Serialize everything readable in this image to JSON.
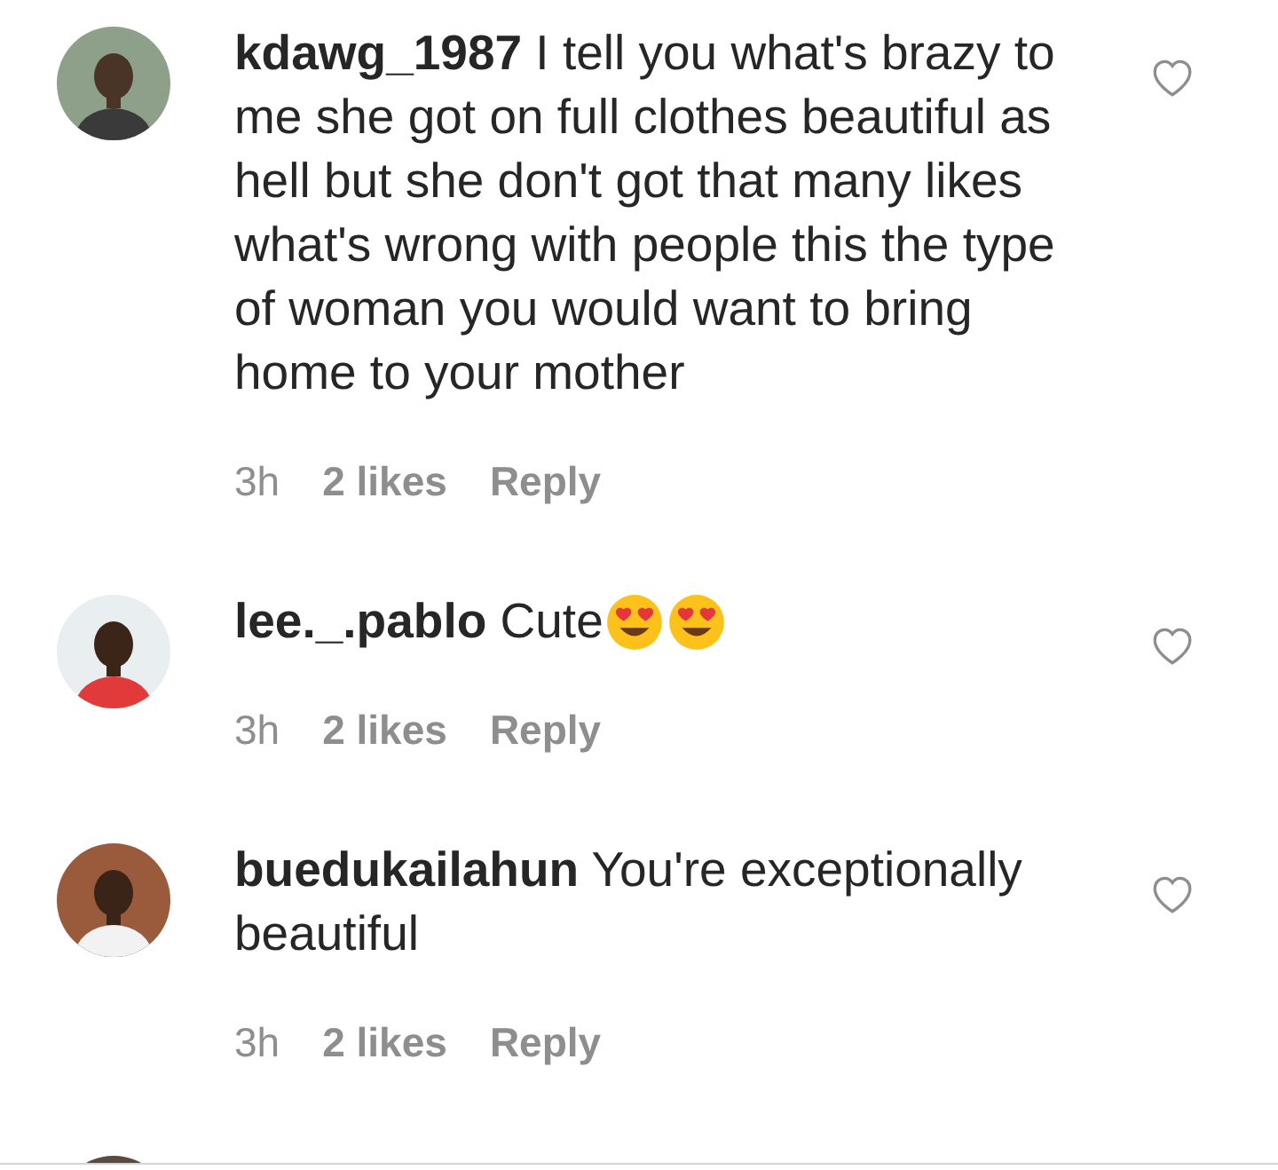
{
  "comments": [
    {
      "kind": "full",
      "username": "kdawg_1987",
      "text": "I tell you what's brazy to me she got on full clothes beautiful as hell but she don't got that many likes what's wrong with people this the type of woman you would want to bring home to your mother",
      "time": "3h",
      "likes": "2 likes",
      "reply": "Reply",
      "liked": false
    },
    {
      "kind": "full",
      "username": "lee._.pablo",
      "text": "Cute",
      "emojis": [
        {
          "kind": "heart-eyes"
        },
        {
          "kind": "heart-eyes"
        }
      ],
      "time": "3h",
      "likes": "2 likes",
      "reply": "Reply",
      "liked": false
    },
    {
      "kind": "full",
      "username": "buedukailahun",
      "text": "You're exceptionally beautiful",
      "time": "3h",
      "likes": "2 likes",
      "reply": "Reply",
      "liked": false
    },
    {
      "kind": "partial"
    }
  ]
}
